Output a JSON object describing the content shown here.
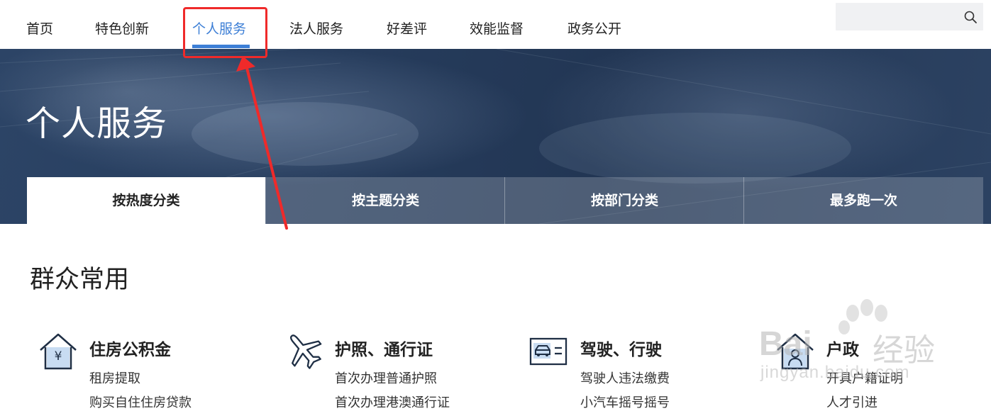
{
  "nav": {
    "items": [
      "首页",
      "特色创新",
      "个人服务",
      "法人服务",
      "好差评",
      "效能监督",
      "政务公开"
    ],
    "active_index": 2
  },
  "search": {
    "placeholder": "",
    "icon": "search-icon"
  },
  "hero": {
    "title": "个人服务",
    "tabs": [
      "按热度分类",
      "按主题分类",
      "按部门分类",
      "最多跑一次"
    ],
    "active_tab": 0
  },
  "section": {
    "title": "群众常用"
  },
  "categories": [
    {
      "icon": "house-yuan-icon",
      "title": "住房公积金",
      "links": [
        "租房提取",
        "购买自住住房贷款"
      ]
    },
    {
      "icon": "airplane-icon",
      "title": "护照、通行证",
      "links": [
        "首次办理普通护照",
        "首次办理港澳通行证"
      ]
    },
    {
      "icon": "driver-license-icon",
      "title": "驾驶、行驶",
      "links": [
        "驾驶人违法缴费",
        "小汽车摇号摇号"
      ]
    },
    {
      "icon": "household-register-icon",
      "title": "户政",
      "links": [
        "开具户籍证明",
        "人才引进"
      ]
    }
  ],
  "watermark": {
    "brand": "Bai",
    "brand_cn": "经验",
    "url": "jingyan.baidu.com"
  },
  "colors": {
    "accent": "#3d7fd6",
    "annotation": "#ef2a2a",
    "hero": "#263c5c"
  }
}
